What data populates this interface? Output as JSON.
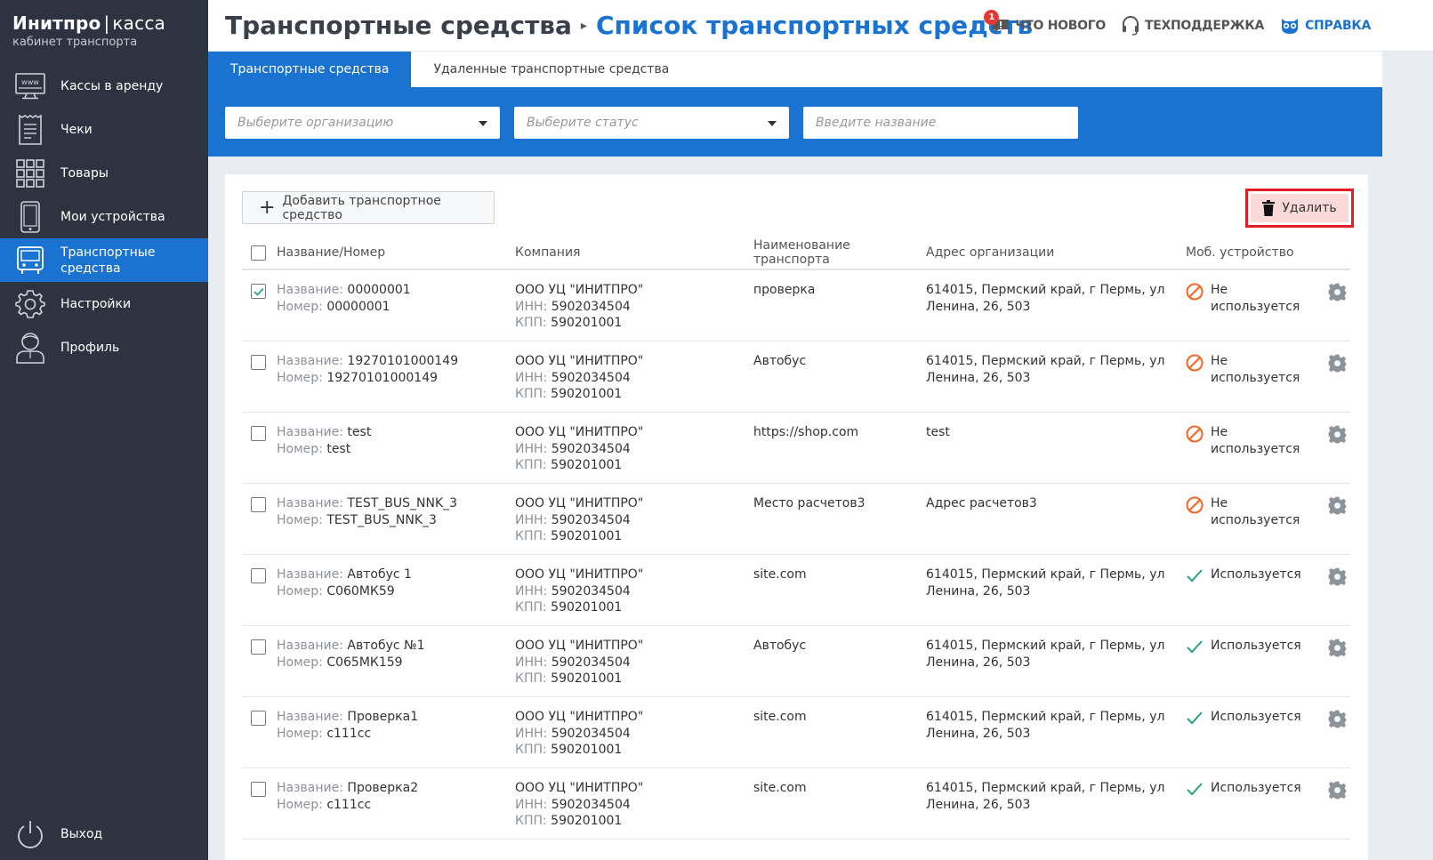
{
  "sidebar": {
    "brand_title": "Инитпро",
    "brand_sep": "|",
    "brand_suffix": "касса",
    "brand_subtitle": "кабинет транспорта",
    "items": [
      {
        "label": "Кассы в аренду",
        "icon": "www-monitor-icon"
      },
      {
        "label": "Чеки",
        "icon": "receipt-icon"
      },
      {
        "label": "Товары",
        "icon": "grid-icon"
      },
      {
        "label": "Мои устройства",
        "icon": "phone-icon"
      },
      {
        "label": "Транспортные средства",
        "icon": "bus-icon",
        "active": true
      },
      {
        "label": "Настройки",
        "icon": "gear-icon"
      },
      {
        "label": "Профиль",
        "icon": "user-icon"
      }
    ],
    "logout_label": "Выход"
  },
  "header": {
    "breadcrumb_root": "Транспортные средства",
    "breadcrumb_current": "Список транспортных средств",
    "whats_new": "Что нового",
    "whats_new_badge": "1",
    "support": "Техподдержка",
    "help": "Справка"
  },
  "tabs": [
    {
      "label": "Транспортные средства",
      "active": true
    },
    {
      "label": "Удаленные транспортные средства",
      "active": false
    }
  ],
  "filters": {
    "org_placeholder": "Выберите организацию",
    "status_placeholder": "Выберите статус",
    "name_placeholder": "Введите название"
  },
  "toolbar": {
    "add_label": "Добавить транспортное средство",
    "delete_label": "Удалить"
  },
  "table": {
    "columns": [
      "Название/Номер",
      "Компания",
      "Наименование транспорта",
      "Адрес организации",
      "Моб. устройство"
    ],
    "name_prefix": "Название: ",
    "number_prefix": "Номер: ",
    "inn_prefix": "ИНН: ",
    "kpp_prefix": "КПП: ",
    "rows": [
      {
        "checked": true,
        "name": "00000001",
        "number": "00000001",
        "company": "ООО УЦ \"ИНИТПРО\"",
        "inn": "5902034504",
        "kpp": "590201001",
        "vehicle": "проверка",
        "address": "614015, Пермский край, г Пермь, ул Ленина, 26, 503",
        "status": "Не используется",
        "in_use": false
      },
      {
        "checked": false,
        "name": "19270101000149",
        "number": "19270101000149",
        "company": "ООО УЦ \"ИНИТПРО\"",
        "inn": "5902034504",
        "kpp": "590201001",
        "vehicle": "Автобус",
        "address": "614015, Пермский край, г Пермь, ул Ленина, 26, 503",
        "status": "Не используется",
        "in_use": false
      },
      {
        "checked": false,
        "name": "test",
        "number": "test",
        "company": "ООО УЦ \"ИНИТПРО\"",
        "inn": "5902034504",
        "kpp": "590201001",
        "vehicle": "https://shop.com",
        "address": "test",
        "status": "Не используется",
        "in_use": false
      },
      {
        "checked": false,
        "name": "TEST_BUS_NNK_3",
        "number": "TEST_BUS_NNK_3",
        "company": "ООО УЦ \"ИНИТПРО\"",
        "inn": "5902034504",
        "kpp": "590201001",
        "vehicle": "Место расчетов3",
        "address": "Адрес расчетов3",
        "status": "Не используется",
        "in_use": false
      },
      {
        "checked": false,
        "name": "Автобус 1",
        "number": "С060МК59",
        "company": "ООО УЦ \"ИНИТПРО\"",
        "inn": "5902034504",
        "kpp": "590201001",
        "vehicle": "site.com",
        "address": "614015, Пермский край, г Пермь, ул Ленина, 26, 503",
        "status": "Используется",
        "in_use": true
      },
      {
        "checked": false,
        "name": "Автобус №1",
        "number": "С065МК159",
        "company": "ООО УЦ \"ИНИТПРО\"",
        "inn": "5902034504",
        "kpp": "590201001",
        "vehicle": "Автобус",
        "address": "614015, Пермский край, г Пермь, ул Ленина, 26, 503",
        "status": "Используется",
        "in_use": true
      },
      {
        "checked": false,
        "name": "Проверка1",
        "number": "с111сс",
        "company": "ООО УЦ \"ИНИТПРО\"",
        "inn": "5902034504",
        "kpp": "590201001",
        "vehicle": "site.com",
        "address": "614015, Пермский край, г Пермь, ул Ленина, 26, 503",
        "status": "Используется",
        "in_use": true
      },
      {
        "checked": false,
        "name": "Проверка2",
        "number": "с111сс",
        "company": "ООО УЦ \"ИНИТПРО\"",
        "inn": "5902034504",
        "kpp": "590201001",
        "vehicle": "site.com",
        "address": "614015, Пермский край, г Пермь, ул Ленина, 26, 503",
        "status": "Используется",
        "in_use": true
      }
    ]
  },
  "colors": {
    "sidebar_bg": "#2d3340",
    "accent": "#1a73d0",
    "danger_border": "#e21d25",
    "danger_bg": "#fbd9d9",
    "not_used": "#f26522",
    "used": "#27a37a"
  }
}
